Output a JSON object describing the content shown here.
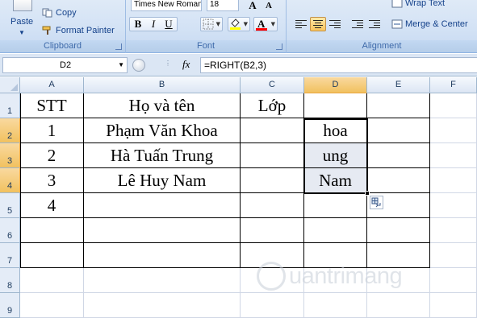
{
  "ribbon": {
    "clipboard": {
      "paste_label": "Paste",
      "copy_label": "Copy",
      "format_painter_label": "Format Painter",
      "group_label": "Clipboard"
    },
    "font": {
      "font_name": "Times New Roman",
      "font_size": "18",
      "bold": "B",
      "italic": "I",
      "underline": "U",
      "grow": "A",
      "shrink": "A",
      "font_color_glyph": "A",
      "group_label": "Font"
    },
    "alignment": {
      "wrap_text_label": "Wrap Text",
      "merge_center_label": "Merge & Center",
      "group_label": "Alignment"
    }
  },
  "formula_bar": {
    "name_box": "D2",
    "fx": "fx",
    "formula": "=RIGHT(B2,3)"
  },
  "columns": [
    "A",
    "B",
    "C",
    "D",
    "E",
    "F"
  ],
  "rows": [
    "1",
    "2",
    "3",
    "4",
    "5",
    "6",
    "7",
    "8",
    "9"
  ],
  "cells": {
    "A1": "STT",
    "B1": "Họ và tên",
    "C1": "Lớp",
    "D1": "",
    "A2": "1",
    "B2": "Phạm Văn Khoa",
    "C2": "",
    "D2": "hoa",
    "A3": "2",
    "B3": "Hà Tuấn Trung",
    "C3": "",
    "D3": "ung",
    "A4": "3",
    "B4": "Lê Huy Nam",
    "C4": "",
    "D4": "Nam",
    "A5": "4",
    "B5": "",
    "C5": "",
    "D5": ""
  },
  "selection": {
    "active_cell": "D2",
    "range": "D2:D4",
    "colors": {
      "header_highlight": "#f1c15f",
      "range_fill": "#e6eaf2"
    }
  },
  "watermark": {
    "text": "uantrimang"
  }
}
